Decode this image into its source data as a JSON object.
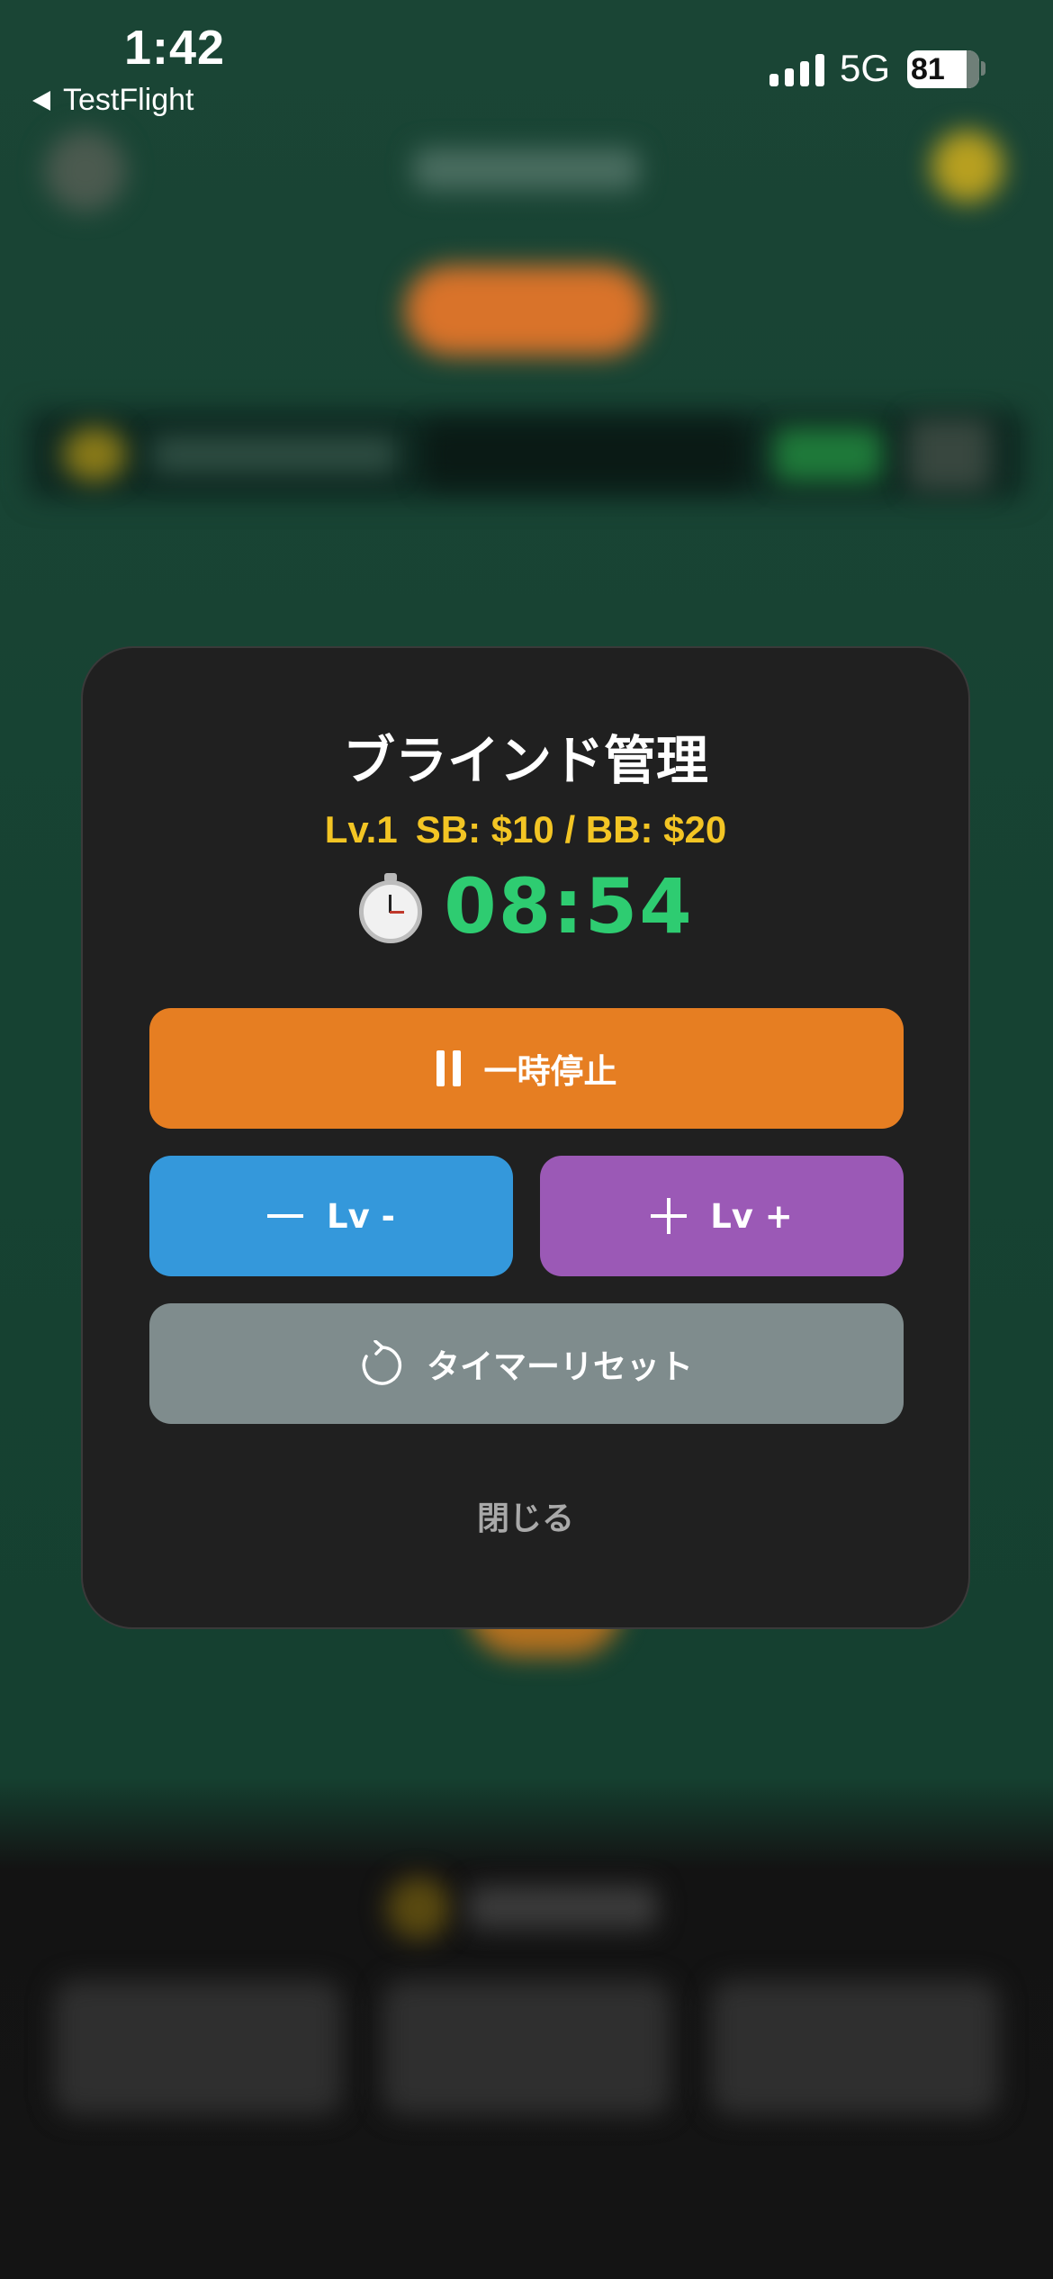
{
  "status_bar": {
    "time": "1:42",
    "back_label": "TestFlight",
    "network": "5G",
    "battery": "81"
  },
  "modal": {
    "title": "ブラインド管理",
    "level": "Lv.1",
    "blinds": "SB: $10 / BB: $20",
    "timer": "08:54",
    "buttons": {
      "pause": "一時停止",
      "level_down": "Lv -",
      "level_up": "Lv +",
      "reset": "タイマーリセット"
    },
    "close": "閉じる"
  },
  "colors": {
    "pause": "#e67e22",
    "level_down": "#3498db",
    "level_up": "#9b59b6",
    "reset": "#7f8c8d",
    "timer": "#2ecc71",
    "blind_info": "#f3c524"
  },
  "icons": {
    "timer": "stopwatch-icon",
    "pause": "pause-icon",
    "level_down": "minus-icon",
    "level_up": "plus-icon",
    "reset": "refresh-icon",
    "back": "back-arrow-icon"
  }
}
